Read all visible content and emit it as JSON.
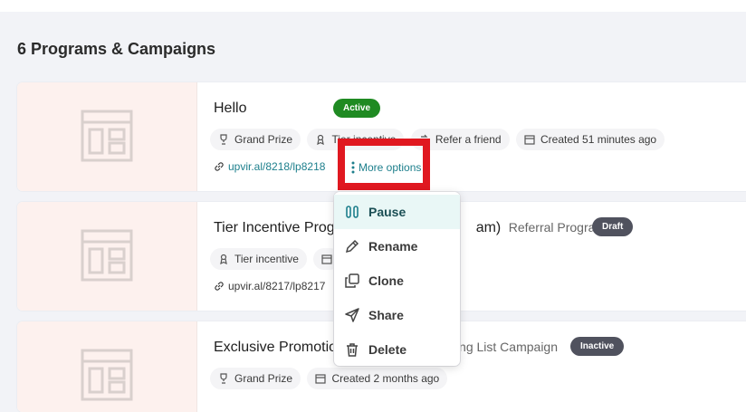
{
  "page": {
    "title": "6 Programs & Campaigns"
  },
  "programs": [
    {
      "title": "Hello",
      "status": "Active",
      "chips": [
        "Grand Prize",
        "Tier incentive",
        "Refer a friend",
        "Created 51 minutes ago"
      ],
      "link": "upvir.al/8218/lp8218",
      "more_options": "More options"
    },
    {
      "title": "Tier Incentive Prog",
      "title_tail": "am)",
      "subtitle": "Referral Program",
      "status": "Draft",
      "chips": [
        "Tier incentive"
      ],
      "link": "upvir.al/8217/lp8217"
    },
    {
      "title": "Exclusive Promotio",
      "subtitle": "ting List Campaign",
      "status": "Inactive",
      "chips": [
        "Grand Prize",
        "Created 2 months ago"
      ]
    }
  ],
  "menu": {
    "items": [
      "Pause",
      "Rename",
      "Clone",
      "Share",
      "Delete"
    ]
  },
  "colors": {
    "accent": "#1d7f8c",
    "active": "#1f8a22",
    "neutral_badge": "#50525e",
    "highlight": "#e01820",
    "thumb_bg": "#fdf1ee"
  }
}
